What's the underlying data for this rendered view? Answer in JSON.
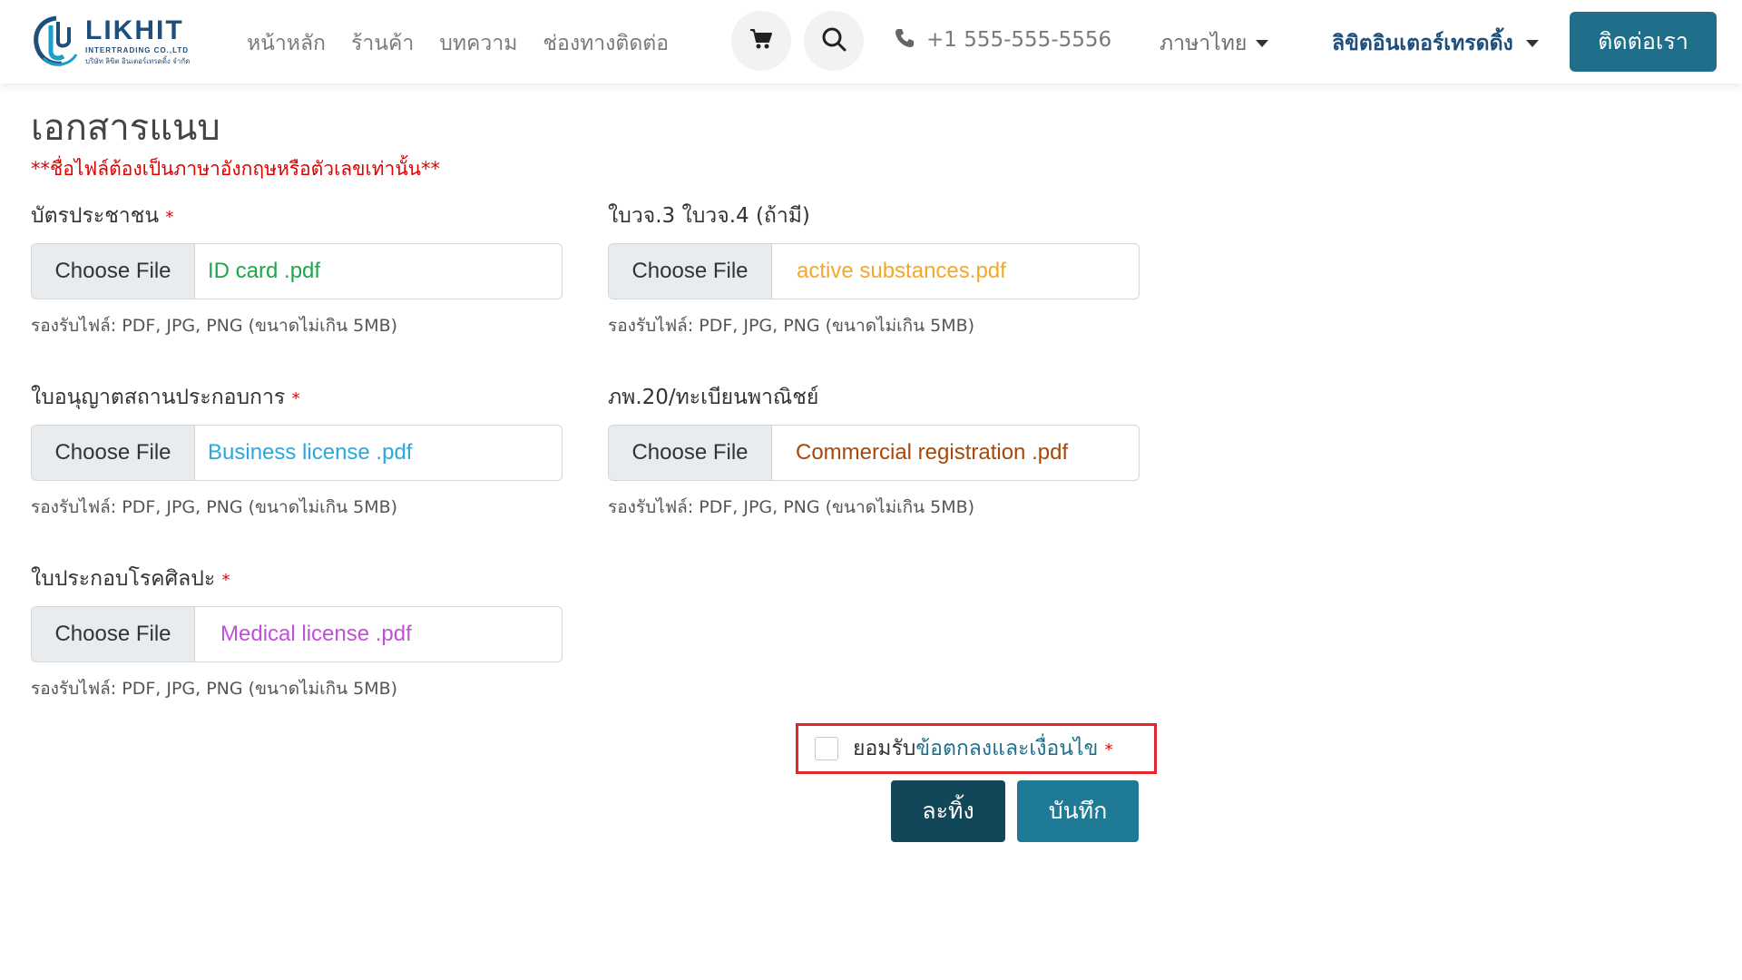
{
  "header": {
    "logo": {
      "brand": "LIKHIT",
      "sub1": "INTERTRADING CO.,LTD",
      "sub2": "บริษัท ลิขิต อินเตอร์เทรดดิ้ง จำกัด"
    },
    "nav": [
      {
        "label": "หน้าหลัก"
      },
      {
        "label": "ร้านค้า"
      },
      {
        "label": "บทความ"
      },
      {
        "label": "ช่องทางติดต่อ"
      }
    ],
    "cart_icon": "cart-icon",
    "search_icon": "search-icon",
    "phone": "+1 555-555-5556",
    "language": "ภาษาไทย",
    "company": "ลิขิตอินเตอร์เทรดดิ้ง",
    "contact_button": "ติดต่อเรา"
  },
  "section": {
    "title": "เอกสารแนบ",
    "warning": "**ชื่อไฟล์ต้องเป็นภาษาอังกฤษหรือตัวเลขเท่านั้น**"
  },
  "common": {
    "choose_file": "Choose File",
    "hint": "รองรับไฟล์: PDF, JPG, PNG (ขนาดไม่เกิน 5MB)",
    "required_mark": "*"
  },
  "fields": [
    {
      "label": "บัตรประชาชน",
      "file": "ID card .pdf",
      "color": "#1aa84b",
      "required": true
    },
    {
      "label": "ใบวจ.3 ใบวจ.4 (ถ้ามี)",
      "file": "active substances.pdf",
      "color": "#f2a92b",
      "required": false
    },
    {
      "label": "ใบอนุญาตสถานประกอบการ",
      "file": "Business license .pdf",
      "color": "#2aa7df",
      "required": true
    },
    {
      "label": "ภพ.20/ทะเบียนพาณิชย์",
      "file": "Commercial registration .pdf",
      "color": "#a8470a",
      "required": false
    },
    {
      "label": "ใบประกอบโรคศิลปะ",
      "file": "Medical license .pdf",
      "color": "#c050d8",
      "required": true
    }
  ],
  "terms": {
    "prefix": "ยอมรับ",
    "link": "ข้อตกลงและเงื่อนไข",
    "required_mark": "*"
  },
  "actions": {
    "cancel": "ละทิ้ง",
    "save": "บันทึก"
  },
  "colors": {
    "primary": "#1f6f8b",
    "dark": "#12475a",
    "required": "#e00000",
    "highlight_border": "#e3262e"
  }
}
